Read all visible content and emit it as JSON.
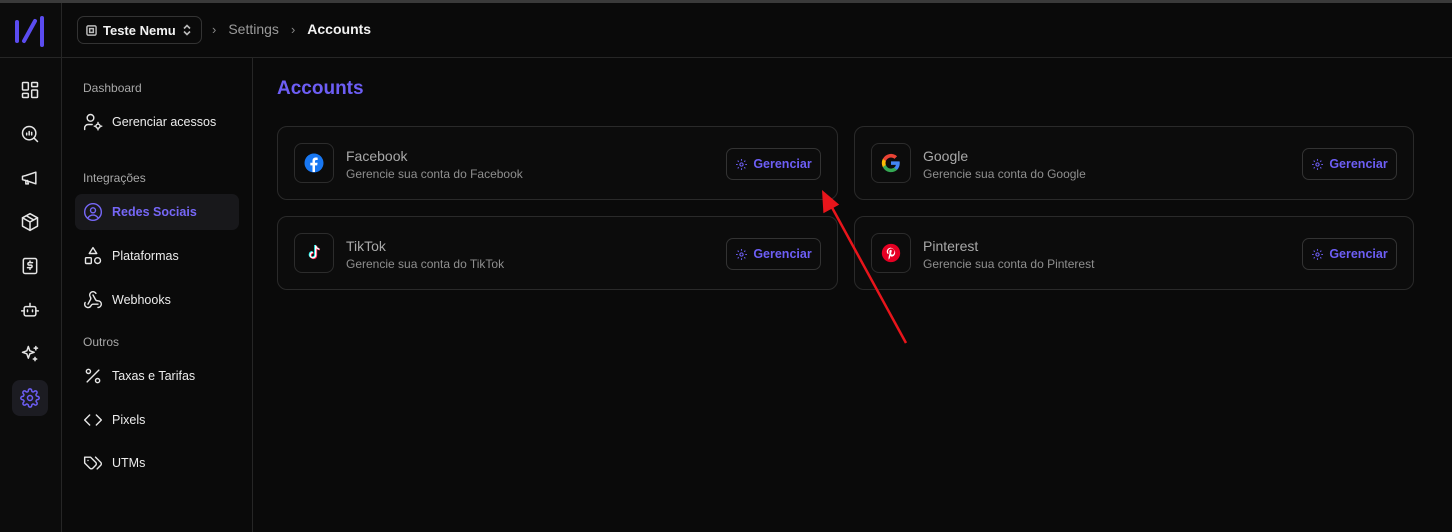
{
  "header": {
    "workspace": "Teste Nemu",
    "breadcrumb": [
      "Settings",
      "Accounts"
    ]
  },
  "rail": {
    "items": [
      "dashboard-icon",
      "search-analytics-icon",
      "megaphone-icon",
      "package-icon",
      "receipt-dollar-icon",
      "bot-icon",
      "sparkles-icon",
      "settings-gear-icon"
    ],
    "active": "settings-gear-icon"
  },
  "sidebar": {
    "sections": [
      {
        "label": "Dashboard",
        "items": [
          {
            "label": "Gerenciar acessos",
            "icon": "user-cog-icon"
          }
        ]
      },
      {
        "label": "Integrações",
        "items": [
          {
            "label": "Redes Sociais",
            "icon": "user-circle-icon",
            "active": true
          },
          {
            "label": "Plataformas",
            "icon": "shapes-icon"
          },
          {
            "label": "Webhooks",
            "icon": "webhook-icon"
          }
        ]
      },
      {
        "label": "Outros",
        "items": [
          {
            "label": "Taxas e Tarifas",
            "icon": "percent-icon"
          },
          {
            "label": "Pixels",
            "icon": "code-icon"
          },
          {
            "label": "UTMs",
            "icon": "tags-icon"
          }
        ]
      }
    ]
  },
  "main": {
    "title": "Accounts",
    "accounts": [
      {
        "name": "Facebook",
        "description": "Gerencie sua conta do Facebook",
        "button": "Gerenciar",
        "icon": "facebook-icon"
      },
      {
        "name": "Google",
        "description": "Gerencie sua conta do Google",
        "button": "Gerenciar",
        "icon": "google-icon"
      },
      {
        "name": "TikTok",
        "description": "Gerencie sua conta do TikTok",
        "button": "Gerenciar",
        "icon": "tiktok-icon"
      },
      {
        "name": "Pinterest",
        "description": "Gerencie sua conta do Pinterest",
        "button": "Gerenciar",
        "icon": "pinterest-icon"
      }
    ]
  },
  "colors": {
    "accent": "#6d5ef5",
    "background": "#0a0a0a",
    "annotation_arrow": "#e8151b"
  }
}
